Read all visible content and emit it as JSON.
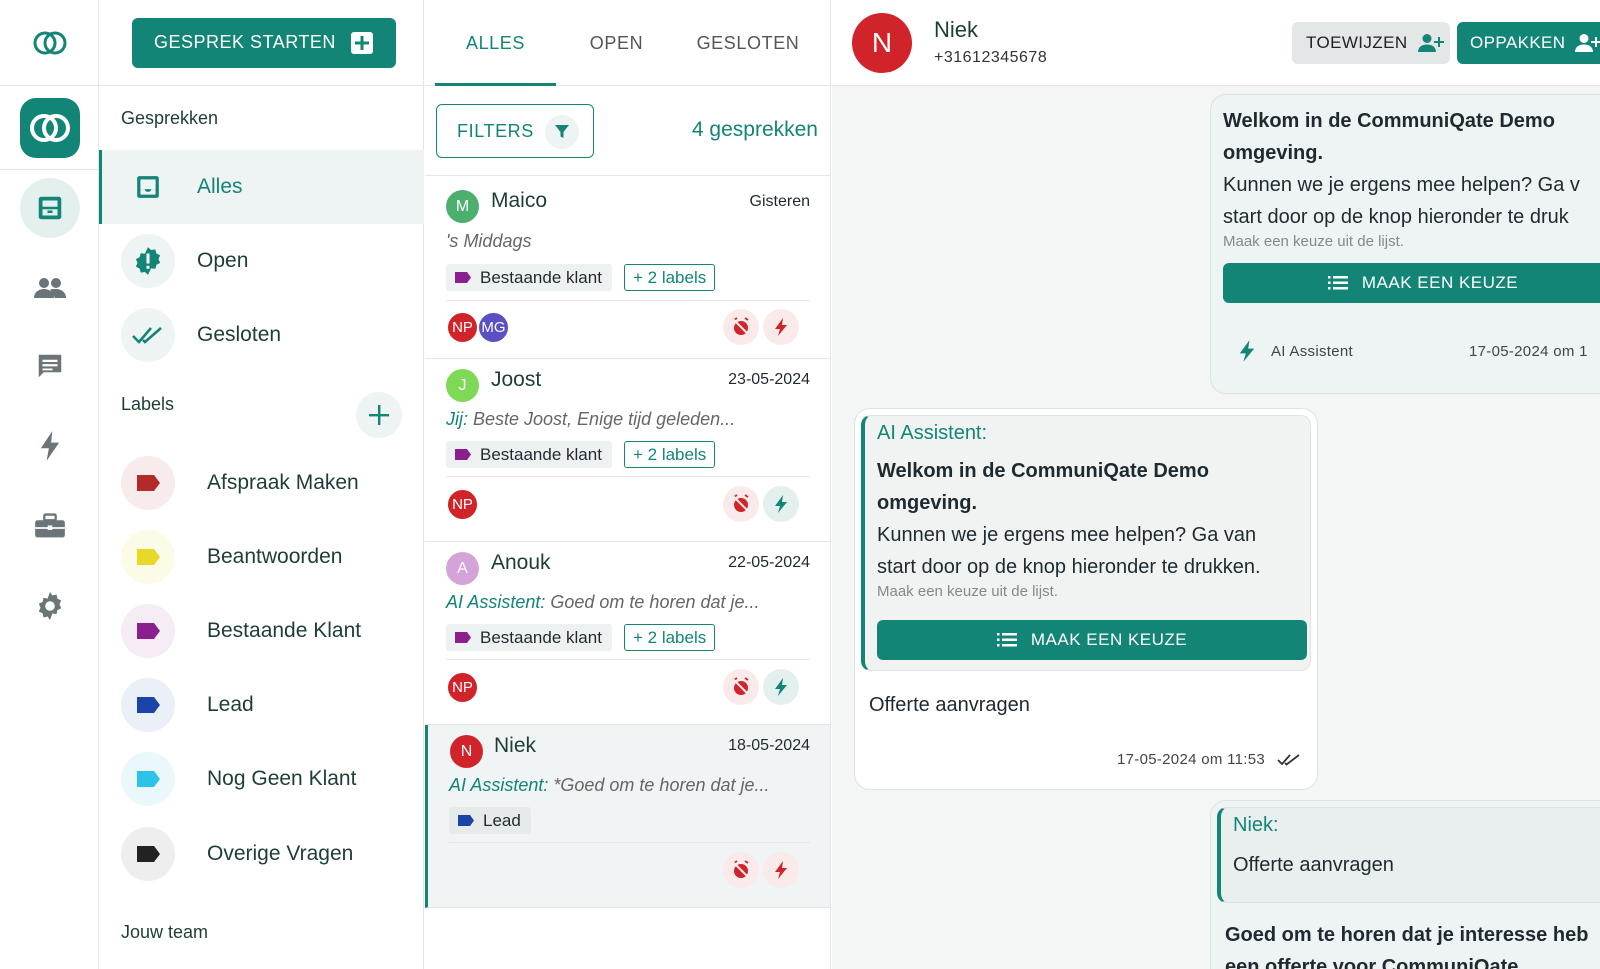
{
  "colors": {
    "accent": "#138577",
    "danger": "#d1232a"
  },
  "sidebar": {
    "start_button": "GESPREK STARTEN",
    "section_conversations": "Gesprekken",
    "nav": [
      {
        "label": "Alles",
        "icon": "inbox-icon"
      },
      {
        "label": "Open",
        "icon": "alert-badge-icon"
      },
      {
        "label": "Gesloten",
        "icon": "double-check-icon"
      }
    ],
    "section_labels": "Labels",
    "labels": [
      {
        "name": "Afspraak Maken",
        "color": "#b22a2a"
      },
      {
        "name": "Beantwoorden",
        "color": "#e6d92a"
      },
      {
        "name": "Bestaande Klant",
        "color": "#8a1f8f"
      },
      {
        "name": "Lead",
        "color": "#1a44a8"
      },
      {
        "name": "Nog Geen Klant",
        "color": "#2bc3ea"
      },
      {
        "name": "Overige Vragen",
        "color": "#222222"
      }
    ],
    "section_team": "Jouw team"
  },
  "list": {
    "tabs": [
      "ALLES",
      "OPEN",
      "GESLOTEN"
    ],
    "filters_label": "FILTERS",
    "count_label": "4 gesprekken",
    "conversations": [
      {
        "initial": "M",
        "avatar_color": "#4caf6e",
        "name": "Maico",
        "date": "Gisteren",
        "who": "",
        "preview": "'s Middags",
        "tag": "Bestaande klant",
        "tag_color": "#8a1f8f",
        "more": "+ 2 labels",
        "agents": [
          {
            "initials": "NP",
            "color": "#d1232a"
          },
          {
            "initials": "MG",
            "color": "#5b4fc4"
          }
        ]
      },
      {
        "initial": "J",
        "avatar_color": "#7ed957",
        "name": "Joost",
        "date": "23-05-2024",
        "who": "Jij:",
        "preview": " Beste Joost, Enige tijd geleden...",
        "tag": "Bestaande klant",
        "tag_color": "#8a1f8f",
        "more": "+ 2 labels",
        "agents": [
          {
            "initials": "NP",
            "color": "#d1232a"
          }
        ]
      },
      {
        "initial": "A",
        "avatar_color": "#d4a3d8",
        "name": "Anouk",
        "date": "22-05-2024",
        "who": "AI Assistent:",
        "preview": " Goed om te horen dat je...",
        "tag": "Bestaande klant",
        "tag_color": "#8a1f8f",
        "more": "+ 2 labels",
        "agents": [
          {
            "initials": "NP",
            "color": "#d1232a"
          }
        ]
      },
      {
        "initial": "N",
        "avatar_color": "#d1232a",
        "name": "Niek",
        "date": "18-05-2024",
        "who": "AI Assistent:",
        "preview": " *Goed om te horen dat je...",
        "tag": "Lead",
        "tag_color": "#1a44a8",
        "more": "",
        "agents": []
      }
    ]
  },
  "chat": {
    "contact_initial": "N",
    "contact_name": "Niek",
    "contact_phone": "+31612345678",
    "assign_label": "TOEWIJZEN",
    "pick_label": "OPPAKKEN",
    "msg1": {
      "bold1": "Welkom in de CommuniQate Demo",
      "bold2": "omgeving.",
      "line1": "Kunnen we je ergens mee helpen? Ga v",
      "line2": "start door op de knop hieronder te druk",
      "hint": "Maak een keuze uit de lijst.",
      "button": "MAAK EEN KEUZE",
      "sender": "AI Assistent",
      "time": "17-05-2024 om 1"
    },
    "msg2": {
      "quote_who": "AI Assistent:",
      "bold1": "Welkom in de CommuniQate Demo",
      "bold2": "omgeving.",
      "line1": "Kunnen we je ergens mee helpen? Ga van",
      "line2": "start door op de knop hieronder te drukken.",
      "hint": "Maak een keuze uit de lijst.",
      "button": "MAAK EEN KEUZE",
      "reply": "Offerte aanvragen",
      "time": "17-05-2024 om 11:53"
    },
    "msg3": {
      "quote_who": "Niek:",
      "quote_text": "Offerte aanvragen",
      "bold1": "Goed om te horen dat je interesse heb",
      "bold2": "een offerte voor CommuniQate"
    }
  }
}
